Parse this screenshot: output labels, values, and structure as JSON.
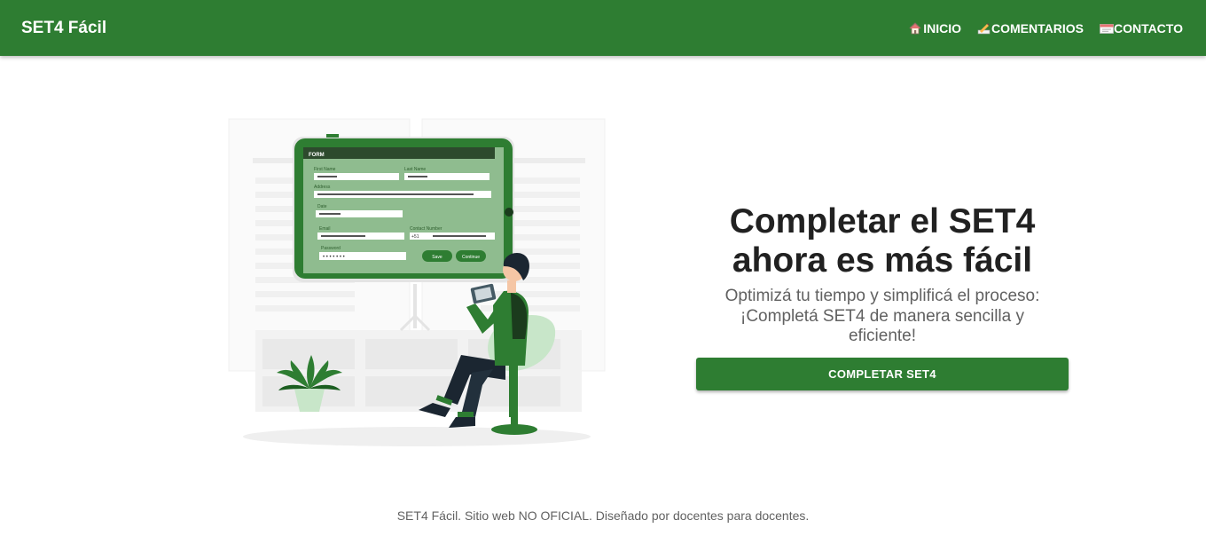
{
  "navbar": {
    "brand": "SET4 Fácil",
    "items": [
      {
        "icon": "house-icon",
        "label": "INICIO"
      },
      {
        "icon": "writing-hand-icon",
        "label": "COMENTARIOS"
      },
      {
        "icon": "envelope-icon",
        "label": "CONTACTO"
      }
    ]
  },
  "illustration": {
    "form_header": "FORM",
    "fields": [
      "First Name",
      "Last Name",
      "Address",
      "Date",
      "Email",
      "Contact Number",
      "Password"
    ],
    "country_code": "+51",
    "password_mask": "• • • • • • •",
    "save_label": "Save",
    "continue_label": "Continue"
  },
  "hero": {
    "title": "Completar el SET4 ahora es más fácil",
    "subtitle": "Optimizá tu tiempo y simplificá el proceso: ¡Completá SET4 de manera sencilla y eficiente!",
    "button_label": "COMPLETAR SET4"
  },
  "footer": {
    "text": "SET4 Fácil. Sitio web NO OFICIAL. Diseñado por docentes para docentes."
  },
  "colors": {
    "primary": "#2e7d32",
    "screen_green": "#8fbc8f",
    "text_dark": "#212121",
    "text_muted": "#616161"
  }
}
